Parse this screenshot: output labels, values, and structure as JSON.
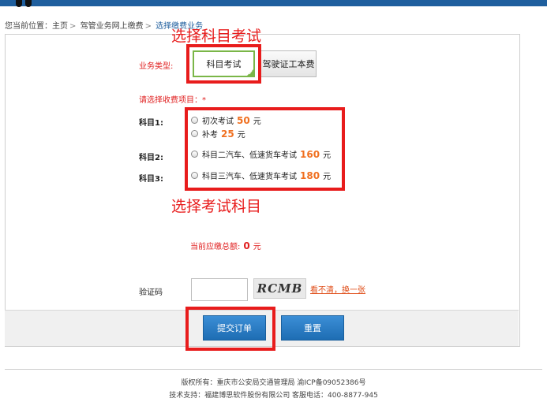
{
  "breadcrumb": {
    "prefix": "您当前位置：",
    "home": "主页",
    "level2": "驾管业务网上缴费",
    "current": "选择缴费业务"
  },
  "form": {
    "business_type_label": "业务类型:",
    "types": [
      {
        "label": "科目考试",
        "selected": true
      },
      {
        "label": "驾驶证工本费",
        "selected": false
      }
    ],
    "select_items_label": "请选择收费项目：*",
    "subjects": [
      {
        "label": "科目1:",
        "options": [
          {
            "text": "初次考试",
            "price": "50",
            "unit": "元"
          },
          {
            "text": "补考",
            "price": "25",
            "unit": "元"
          }
        ]
      },
      {
        "label": "科目2:",
        "options": [
          {
            "text": "科目二汽车、低速货车考试",
            "price": "160",
            "unit": "元"
          }
        ]
      },
      {
        "label": "科目3:",
        "options": [
          {
            "text": "科目三汽车、低速货车考试",
            "price": "180",
            "unit": "元"
          }
        ]
      }
    ],
    "total_label": "当前应缴总额:",
    "total_amount": "0",
    "total_unit": "元",
    "captcha_label": "验证码",
    "captcha_value": "",
    "captcha_image_text": "RCMB",
    "captcha_refresh": "看不清，换一张"
  },
  "actions": {
    "submit": "提交订单",
    "reset": "重置"
  },
  "annotations": {
    "choose_subject_exam": "选择科目考试",
    "choose_exam_subject": "选择考试科目"
  },
  "footer": {
    "line1": "版权所有：重庆市公安局交通管理局   渝ICP备09052386号",
    "line2": "技术支持：福建博思软件股份有限公司   客服电话：400-8877-945"
  },
  "colors": {
    "brand_blue": "#1f5f9e",
    "annotation_red": "#e81c1c",
    "price_orange": "#f07020",
    "selected_green": "#7ab648"
  }
}
